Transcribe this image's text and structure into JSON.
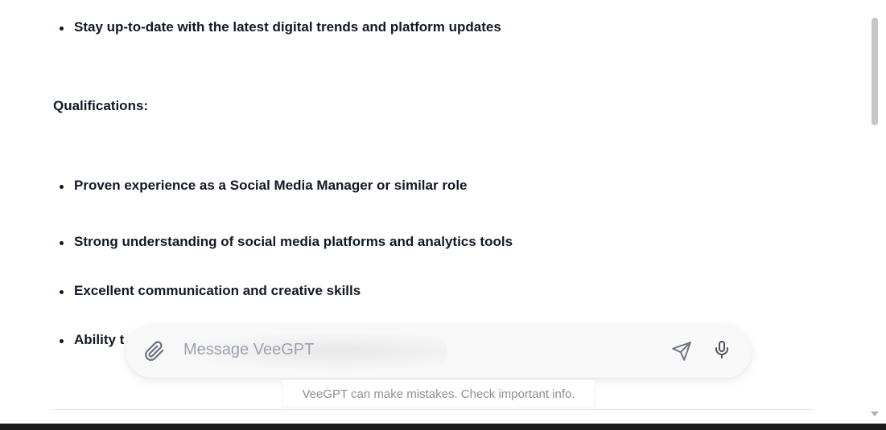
{
  "content": {
    "top_bullet": "Stay up-to-date with the latest digital trends and platform updates",
    "qualifications_heading": "Qualifications:",
    "qualifications": [
      "Proven experience as a Social Media Manager or similar role",
      "Strong understanding of social media platforms and analytics tools",
      "Excellent communication and creative skills",
      "Ability t"
    ]
  },
  "composer": {
    "placeholder": "Message VeeGPT",
    "attach_icon": "paperclip-icon",
    "send_icon": "send-icon",
    "mic_icon": "microphone-icon"
  },
  "disclaimer": "VeeGPT can make mistakes. Check important info.",
  "colors": {
    "text": "#111827",
    "placeholder": "#9ca3af",
    "icon": "#6b7280",
    "disclaimer": "#8b8f98"
  }
}
